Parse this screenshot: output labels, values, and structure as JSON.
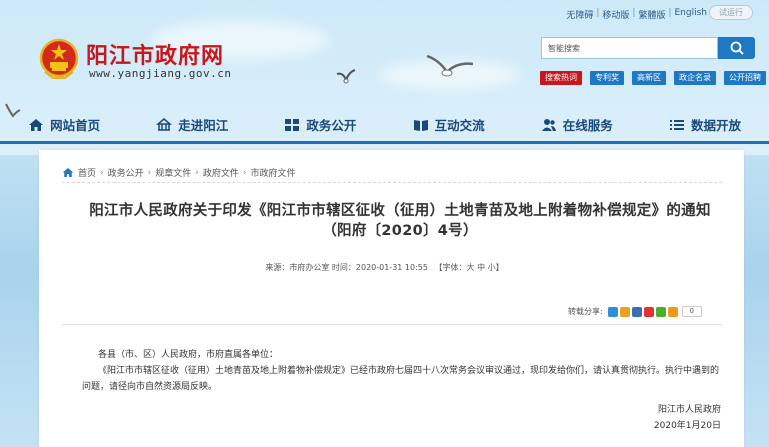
{
  "header": {
    "top_links": [
      "无障碍",
      "移动版",
      "繁體版",
      "English"
    ],
    "trial_button": "试运行",
    "site_title": "阳江市政府网",
    "site_url": "www.yangjiang.gov.cn",
    "search_placeholder": "智能搜索",
    "hot_tags": [
      "搜索热词",
      "专利奖",
      "高新区",
      "政企名录",
      "公开招聘"
    ]
  },
  "nav": {
    "items": [
      "网站首页",
      "走进阳江",
      "政务公开",
      "互动交流",
      "在线服务",
      "数据开放"
    ]
  },
  "breadcrumb": [
    "首页",
    "政务公开",
    "规章文件",
    "政府文件",
    "市政府文件"
  ],
  "article": {
    "title": "阳江市人民政府关于印发《阳江市市辖区征收（征用）土地青苗及地上附着物补偿规定》的通知 （阳府〔2020〕4号）",
    "meta": "来源：市府办公室 时间：2020-01-31 10:55",
    "font_size_label": "【字体：大 中 小】",
    "share_label": "转载分享:",
    "share_count": "0",
    "greeting": "各县（市、区）人民政府，市府直属各单位：",
    "paragraph": "《阳江市市辖区征收（征用）土地青苗及地上附着物补偿规定》已经市政府七届四十八次常务会议审议通过，现印发给你们，请认真贯彻执行。执行中遇到的问题，请径向市自然资源局反映。",
    "signature_org": "阳江市人民政府",
    "signature_date": "2020年1月20日"
  },
  "colors": {
    "brand_red": "#c8161d",
    "nav_blue": "#1a4a7a",
    "accent_blue": "#1f78c4"
  }
}
